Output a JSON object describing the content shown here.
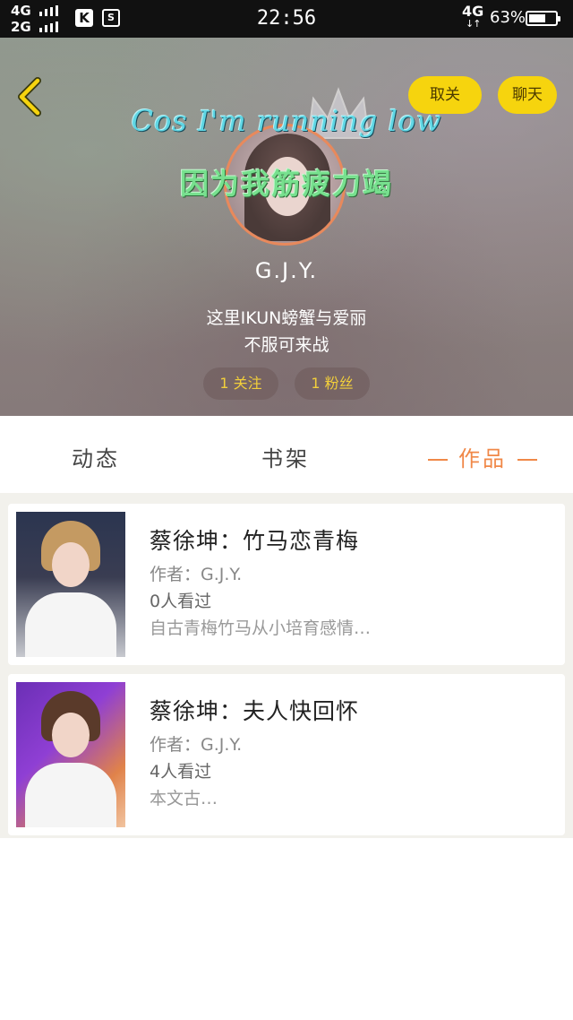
{
  "status_bar": {
    "network_1": "4G",
    "network_2": "2G",
    "app_icon_k": "K",
    "app_icon_s": "S",
    "time": "22:56",
    "data_network": "4G",
    "data_arrows": "↓↑",
    "battery_percent": "63%",
    "battery_level": 0.63
  },
  "header": {
    "unfollow_label": "取关",
    "chat_label": "聊天",
    "lyric_en": "Cos I'm running low",
    "lyric_cn": "因为我筋疲力竭",
    "username": "G.J.Y.",
    "bio_line1": "这里IKUN螃蟹与爱丽",
    "bio_line2": "不服可来战",
    "following_label": "1 关注",
    "fans_label": "1 粉丝",
    "accent_color": "#f6d40e",
    "avatar_ring_color": "#e8895c"
  },
  "tabs": {
    "items": [
      {
        "label": "动态"
      },
      {
        "label": "书架"
      },
      {
        "label": "作品"
      }
    ],
    "active_index": 2,
    "active_color": "#f08848"
  },
  "works": [
    {
      "title": "蔡徐坤：竹马恋青梅",
      "author": "作者：G.J.Y.",
      "views": "0人看过",
      "description": "自古青梅竹马从小培育感情…"
    },
    {
      "title": "蔡徐坤：夫人快回怀",
      "author": "作者：G.J.Y.",
      "views": "4人看过",
      "description": "本文古…"
    }
  ]
}
